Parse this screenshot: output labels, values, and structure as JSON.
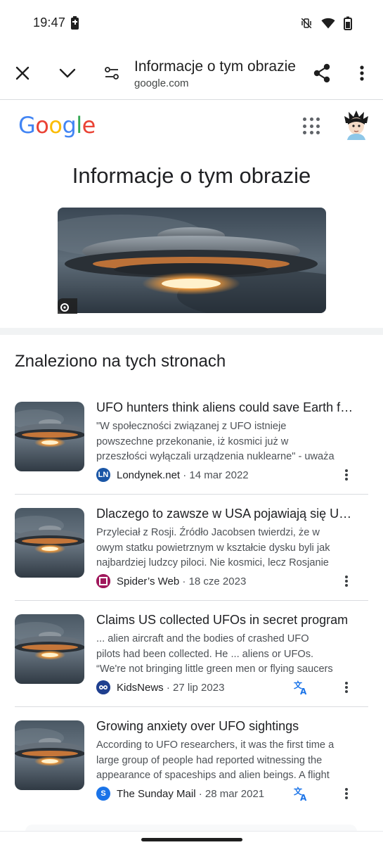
{
  "status_bar": {
    "time": "19:47"
  },
  "toolbar": {
    "title": "Informacje o tym obrazie",
    "url": "google.com"
  },
  "google": {
    "logo": [
      "G",
      "o",
      "o",
      "g",
      "l",
      "e"
    ],
    "logo_colors": [
      "#4285F4",
      "#EA4335",
      "#FBBC05",
      "#4285F4",
      "#34A853",
      "#EA4335"
    ]
  },
  "page": {
    "title": "Informacje o tym obrazie",
    "section_title": "Znaleziono na tych stronach"
  },
  "results": [
    {
      "title": "UFO hunters think aliens could save Earth from nuclear war",
      "snippet": [
        "\"W społeczności związanej z UFO istnieje",
        "powszechne przekonanie, iż kosmici już w",
        "przeszłości wyłączali urządzenia nuklearne\" - uważa"
      ],
      "site": "Londynek.net",
      "date": "14 mar 2022",
      "favicon_text": "LN",
      "favicon_color": "#1a56a6",
      "translated": false
    },
    {
      "title": "Dlaczego to zawsze w USA pojawiają się UFO?",
      "snippet": [
        "Przyleciał z Rosji. Źródło Jacobsen twierdzi, że w",
        "owym statku powietrznym w kształcie dysku byli jak",
        "najbardziej ludzcy piloci. Nie kosmici, lecz Rosjanie"
      ],
      "site": "Spider’s Web",
      "date": "18 cze 2023",
      "favicon_text": "",
      "favicon_color": "#a0185c",
      "translated": false
    },
    {
      "title": "Claims US collected UFOs in secret program",
      "snippet": [
        "... alien aircraft and the bodies of crashed UFO",
        "pilots had been collected. He ... aliens or UFOs.",
        "“We're not bringing little green men or flying saucers"
      ],
      "site": "KidsNews",
      "date": "27 lip 2023",
      "favicon_text": "",
      "favicon_color": "#1f3f8f",
      "translated": true
    },
    {
      "title": "Growing anxiety over UFO sightings",
      "snippet": [
        "According to UFO researchers, it was the first time a",
        "large group of people had reported witnessing the",
        "appearance of spaceships and alien beings. A flight"
      ],
      "site": "The Sunday Mail",
      "date": "28 mar 2021",
      "favicon_text": "S",
      "favicon_color": "#1a73e8",
      "translated": true
    }
  ]
}
